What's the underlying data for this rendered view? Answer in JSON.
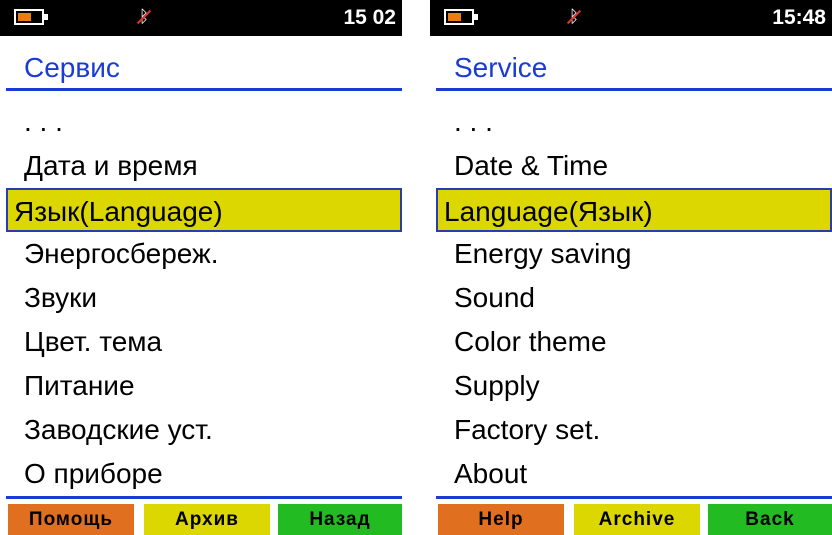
{
  "colors": {
    "status_bg": "#000000",
    "title_blue": "#1a3bd6",
    "selection_bg": "#dcd700",
    "selection_border": "#2a3bb4",
    "battery_fill": "#f07a12",
    "softkey_orange": "#e07020",
    "softkey_yellow": "#dcd700",
    "softkey_green": "#22bb22"
  },
  "screens": [
    {
      "status": {
        "time": "15 02",
        "battery_icon": "battery-icon",
        "bluetooth_icon": "bluetooth-off-icon",
        "bt_glyph": "ᛒ"
      },
      "title": "Сервис",
      "menu": [
        {
          "label": ". . ."
        },
        {
          "label": "Дата  и  время"
        },
        {
          "label": "Язык(Language)",
          "selected": true
        },
        {
          "label": "Энергосбереж."
        },
        {
          "label": "Звуки"
        },
        {
          "label": "Цвет.  тема"
        },
        {
          "label": "Питание"
        },
        {
          "label": "Заводские  уст."
        },
        {
          "label": "О  приборе"
        }
      ],
      "softkeys": [
        {
          "label": "Помощь",
          "color": "#e07020"
        },
        {
          "label": "Архив",
          "color": "#dcd700"
        },
        {
          "label": "Назад",
          "color": "#22bb22"
        }
      ]
    },
    {
      "status": {
        "time": "15:48",
        "battery_icon": "battery-icon",
        "bluetooth_icon": "bluetooth-off-icon",
        "bt_glyph": "ᛒ"
      },
      "title": "Service",
      "menu": [
        {
          "label": ". . ."
        },
        {
          "label": "Date  &  Time"
        },
        {
          "label": "Language(Язык)",
          "selected": true
        },
        {
          "label": "Energy  saving"
        },
        {
          "label": "Sound"
        },
        {
          "label": "Color  theme"
        },
        {
          "label": "Supply"
        },
        {
          "label": "Factory  set."
        },
        {
          "label": "About"
        }
      ],
      "softkeys": [
        {
          "label": "Help",
          "color": "#e07020"
        },
        {
          "label": "Archive",
          "color": "#dcd700"
        },
        {
          "label": "Back",
          "color": "#22bb22"
        }
      ]
    }
  ]
}
